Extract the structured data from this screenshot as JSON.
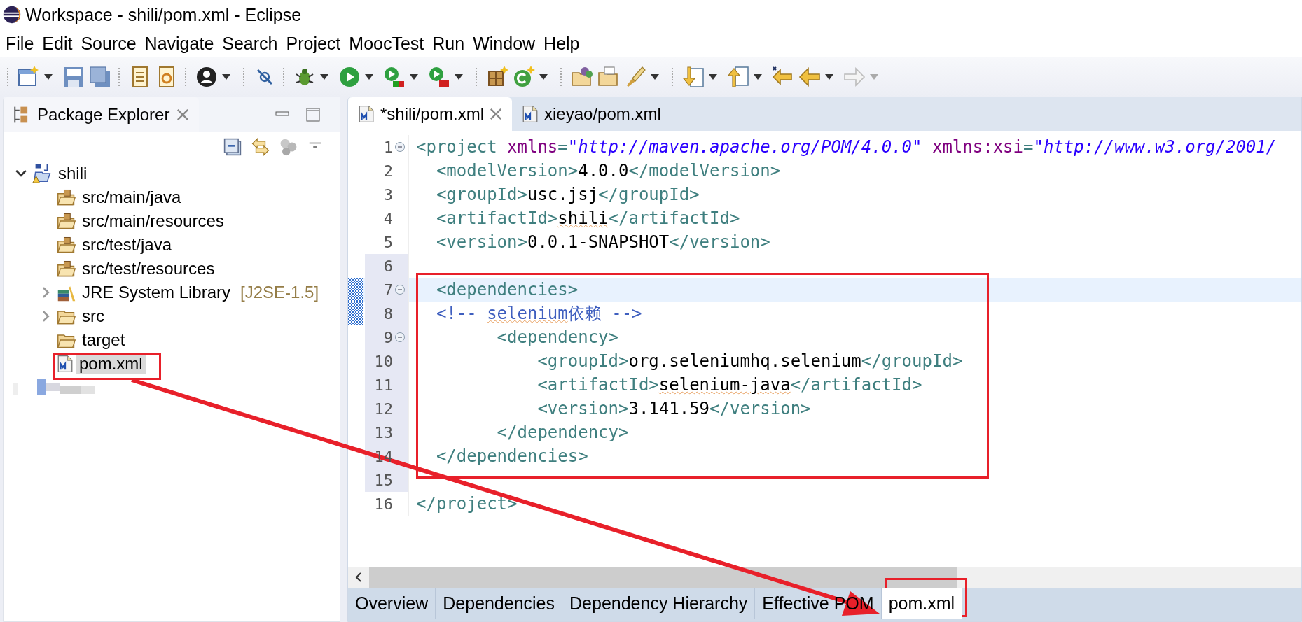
{
  "window": {
    "title": "Workspace - shili/pom.xml - Eclipse"
  },
  "menu": [
    "File",
    "Edit",
    "Source",
    "Navigate",
    "Search",
    "Project",
    "MoocTest",
    "Run",
    "Window",
    "Help"
  ],
  "package_explorer": {
    "title": "Package Explorer",
    "tree": [
      {
        "label": "shili",
        "kind": "project",
        "expanded": true,
        "selected": false,
        "children": [
          {
            "label": "src/main/java",
            "kind": "source_folder",
            "selected": false
          },
          {
            "label": "src/main/resources",
            "kind": "source_folder",
            "selected": false
          },
          {
            "label": "src/test/java",
            "kind": "source_folder",
            "selected": false
          },
          {
            "label": "src/test/resources",
            "kind": "source_folder",
            "selected": false
          },
          {
            "label": "JRE System Library",
            "decoration": "[J2SE-1.5]",
            "kind": "library",
            "expanded": false,
            "selected": false
          },
          {
            "label": "src",
            "kind": "folder",
            "expanded": false,
            "selected": false
          },
          {
            "label": "target",
            "kind": "folder",
            "selected": false
          },
          {
            "label": "pom.xml",
            "kind": "pom",
            "selected": true
          }
        ]
      },
      {
        "kind": "redacted"
      }
    ]
  },
  "editor": {
    "tabs": [
      {
        "label": "*shili/pom.xml",
        "selected": true
      },
      {
        "label": "xieyao/pom.xml",
        "selected": false
      }
    ],
    "lines": [
      {
        "number": "1",
        "foldable": true,
        "current": false,
        "changed": false,
        "in_range": false,
        "tokens": [
          {
            "kind": "tag",
            "text": "<project "
          },
          {
            "kind": "attr",
            "text": "xmlns"
          },
          {
            "kind": "tag",
            "text": "="
          },
          {
            "kind": "string",
            "text": "\"http://maven.apache.org/POM/4.0.0\""
          },
          {
            "kind": "attr",
            "text": " xmlns:xsi"
          },
          {
            "kind": "tag",
            "text": "="
          },
          {
            "kind": "string",
            "text": "\"http://www.w3.org/2001/"
          }
        ]
      },
      {
        "number": "2",
        "foldable": false,
        "current": false,
        "changed": false,
        "in_range": false,
        "tokens": [
          {
            "kind": "tag",
            "text": "  <modelVersion>"
          },
          {
            "kind": "text",
            "text": "4.0.0"
          },
          {
            "kind": "tag",
            "text": "</modelVersion>"
          }
        ]
      },
      {
        "number": "3",
        "foldable": false,
        "current": false,
        "changed": false,
        "in_range": false,
        "tokens": [
          {
            "kind": "tag",
            "text": "  <groupId>"
          },
          {
            "kind": "text",
            "text": "usc.jsj"
          },
          {
            "kind": "tag",
            "text": "</groupId>"
          }
        ]
      },
      {
        "number": "4",
        "foldable": false,
        "current": false,
        "changed": false,
        "in_range": false,
        "tokens": [
          {
            "kind": "tag",
            "text": "  <artifactId>"
          },
          {
            "kind": "text",
            "text": "shili",
            "misspelled": true
          },
          {
            "kind": "tag",
            "text": "</artifactId>"
          }
        ]
      },
      {
        "number": "5",
        "foldable": false,
        "current": false,
        "changed": false,
        "in_range": false,
        "tokens": [
          {
            "kind": "tag",
            "text": "  <version>"
          },
          {
            "kind": "text",
            "text": "0.0.1-SNAPSHOT"
          },
          {
            "kind": "tag",
            "text": "</version>"
          }
        ]
      },
      {
        "number": "6",
        "foldable": false,
        "current": false,
        "changed": false,
        "in_range": true
      },
      {
        "number": "7",
        "foldable": true,
        "current": true,
        "changed": true,
        "in_range": true,
        "tokens": [
          {
            "kind": "tag",
            "text": "  <dependencies>"
          }
        ]
      },
      {
        "number": "8",
        "foldable": false,
        "current": false,
        "changed": true,
        "in_range": true,
        "tokens": [
          {
            "kind": "comment",
            "text": "  <!-- "
          },
          {
            "kind": "comment",
            "text": "selenium",
            "misspelled": true
          },
          {
            "kind": "comment",
            "text": "依赖 -->"
          }
        ]
      },
      {
        "number": "9",
        "foldable": true,
        "current": false,
        "changed": false,
        "in_range": true,
        "tokens": [
          {
            "kind": "tag",
            "text": "        <dependency>"
          }
        ]
      },
      {
        "number": "10",
        "foldable": false,
        "current": false,
        "changed": false,
        "in_range": true,
        "tokens": [
          {
            "kind": "tag",
            "text": "            <groupId>"
          },
          {
            "kind": "text",
            "text": "org.seleniumhq.selenium"
          },
          {
            "kind": "tag",
            "text": "</groupId>"
          }
        ]
      },
      {
        "number": "11",
        "foldable": false,
        "current": false,
        "changed": false,
        "in_range": true,
        "tokens": [
          {
            "kind": "tag",
            "text": "            <artifactId>"
          },
          {
            "kind": "text",
            "text": "selenium-java",
            "misspelled": true
          },
          {
            "kind": "tag",
            "text": "</artifactId>"
          }
        ]
      },
      {
        "number": "12",
        "foldable": false,
        "current": false,
        "changed": false,
        "in_range": true,
        "tokens": [
          {
            "kind": "tag",
            "text": "            <version>"
          },
          {
            "kind": "text",
            "text": "3.141.59"
          },
          {
            "kind": "tag",
            "text": "</version>"
          }
        ]
      },
      {
        "number": "13",
        "foldable": false,
        "current": false,
        "changed": false,
        "in_range": true,
        "tokens": [
          {
            "kind": "tag",
            "text": "        </dependency>"
          }
        ]
      },
      {
        "number": "14",
        "foldable": false,
        "current": false,
        "changed": false,
        "in_range": true,
        "tokens": [
          {
            "kind": "tag",
            "text": "  </dependencies>"
          }
        ]
      },
      {
        "number": "15",
        "foldable": false,
        "current": false,
        "changed": false,
        "in_range": true
      },
      {
        "number": "16",
        "foldable": false,
        "current": false,
        "changed": false,
        "in_range": false,
        "tokens": [
          {
            "kind": "tag",
            "text": "</project>"
          }
        ]
      }
    ],
    "bottom_tabs": [
      {
        "label": "Overview",
        "selected": false
      },
      {
        "label": "Dependencies",
        "selected": false
      },
      {
        "label": "Dependency Hierarchy",
        "selected": false
      },
      {
        "label": "Effective POM",
        "selected": false
      },
      {
        "label": "pom.xml",
        "selected": true
      }
    ]
  }
}
